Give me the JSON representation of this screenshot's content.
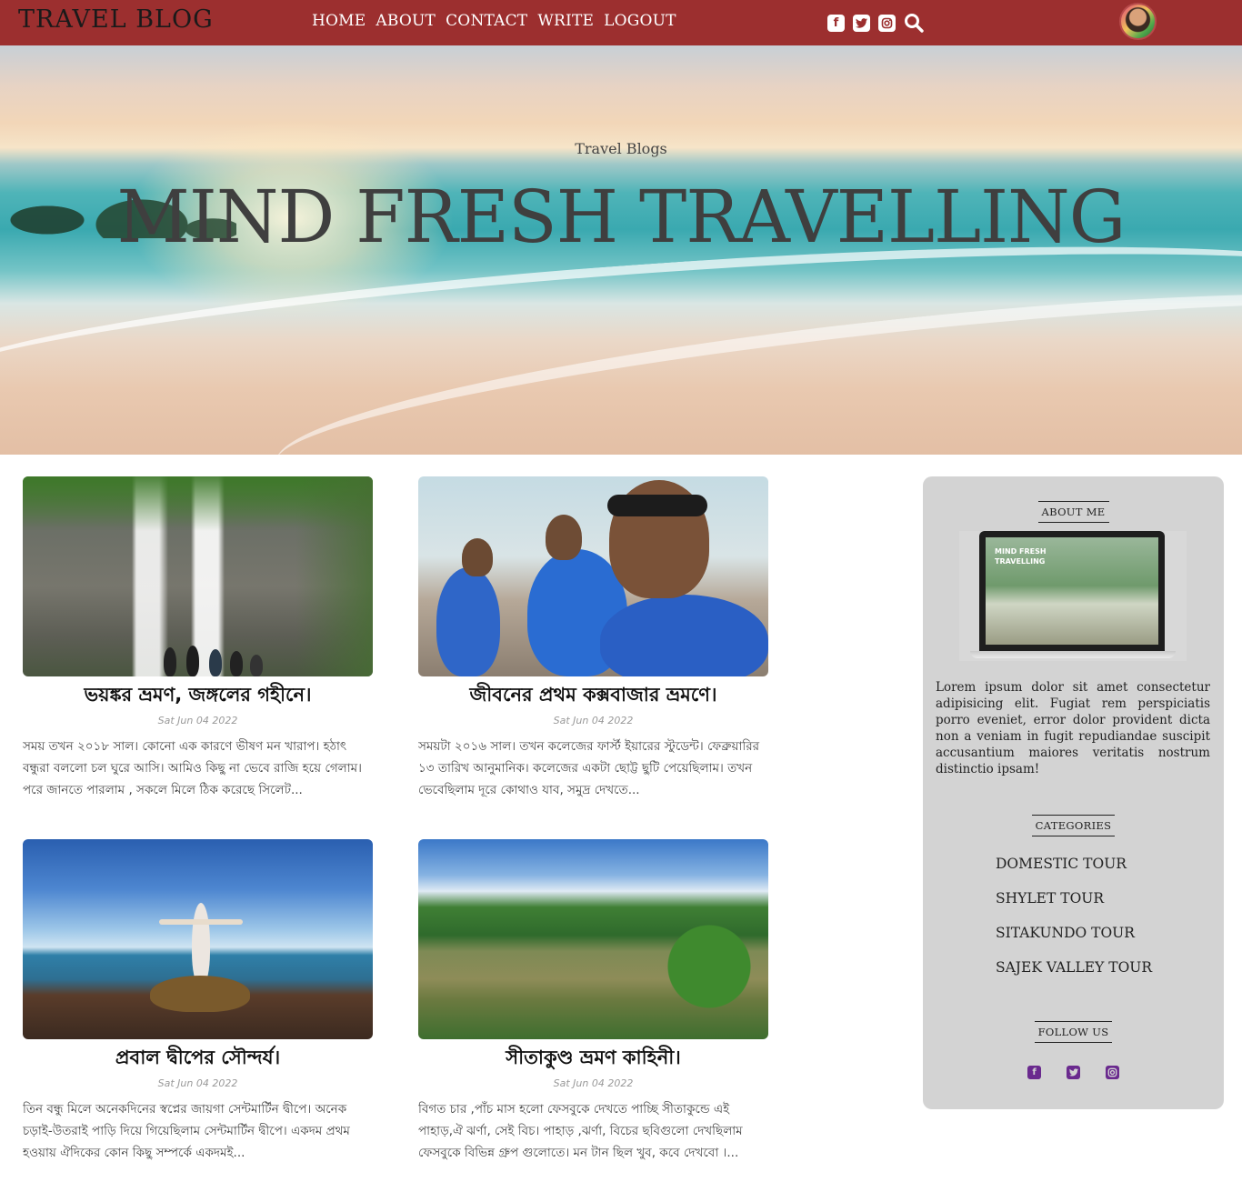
{
  "header": {
    "logo": "TRAVEL BLOG",
    "nav": [
      "HOME",
      "ABOUT",
      "CONTACT",
      "WRITE",
      "LOGOUT"
    ],
    "social_icons": [
      "facebook-square-icon",
      "twitter-square-icon",
      "instagram-icon"
    ],
    "search_icon": "search-icon",
    "colors": {
      "bar": "#9c2f2f",
      "nav_text": "#ffffff"
    }
  },
  "hero": {
    "subtitle": "Travel Blogs",
    "title": "MIND FRESH TRAVELLING"
  },
  "posts": [
    {
      "title": "ভয়ঙ্কর ভ্রমণ, জঙ্গলের গহীনে।",
      "date": "Sat Jun 04 2022",
      "excerpt": "সময় তখন ২০১৮ সাল। কোনো এক কারণে ভীষণ মন খারাপ। হঠাৎ বন্ধুরা বললো চল ঘুরে আসি। আমিও কিছু না ভেবে রাজি হয়ে গেলাম। পরে জানতে পারলাম , সকলে মিলে ঠিক করেছে সিলেট..."
    },
    {
      "title": "জীবনের প্রথম কক্সবাজার ভ্রমণে।",
      "date": "Sat Jun 04 2022",
      "excerpt": "সময়টা ২০১৬ সাল। তখন কলেজের ফার্স্ট ইয়ারের স্টুডেন্ট। ফেব্রুয়ারির ১৩ তারিখ আনুমানিক। কলেজের একটা ছোট্ট ছুটি পেয়েছিলাম। তখন ভেবেছিলাম দূরে কোথাও যাব, সমুদ্র দেখতে..."
    },
    {
      "title": "প্রবাল দ্বীপের সৌন্দর্য।",
      "date": "Sat Jun 04 2022",
      "excerpt": "তিন বন্ধু মিলে অনেকদিনের স্বপ্নের জায়গা সেন্টমার্টিন দ্বীপে। অনেক চড়াই-উতরাই পাড়ি দিয়ে গিয়েছিলাম সেন্টমার্টিন দ্বীপে। একদম প্রথম হওয়ায় ঐদিকের কোন কিছু সম্পর্কে একদমই..."
    },
    {
      "title": "সীতাকুণ্ড ভ্রমণ কাহিনী।",
      "date": "Sat Jun 04 2022",
      "excerpt": "বিগত চার ,পাঁচ মাস হলো ফেসবুকে দেখতে পাচ্ছি সীতাকুন্ডে এই পাহাড়,ঐ ঝর্ণা, সেই বিচ। পাহাড় ,ঝর্ণা, বিচের ছবিগুলো দেখছিলাম ফেসবুকে বিভিন্ন গ্রুপ গুলোতে। মন টান ছিল খুব, কবে দেখবো ।..."
    }
  ],
  "sidebar": {
    "about_heading": "ABOUT ME",
    "about_image_text": "MIND FRESH TRAVELLING",
    "about_text": "Lorem ipsum dolor sit amet consectetur adipisicing elit. Fugiat rem perspiciatis porro eveniet, error dolor provident dicta non a veniam in fugit repudiandae suscipit accusantium maiores veritatis nostrum distinctio ipsam!",
    "categories_heading": "CATEGORIES",
    "categories": [
      "DOMESTIC TOUR",
      "SHYLET TOUR",
      "SITAKUNDO TOUR",
      "SAJEK VALLEY TOUR"
    ],
    "follow_heading": "FOLLOW US",
    "follow_icons": [
      "facebook-square-icon",
      "twitter-square-icon",
      "instagram-icon"
    ],
    "colors": {
      "panel": "#d3d3d3",
      "follow_icons": "#6a2a8e"
    }
  }
}
